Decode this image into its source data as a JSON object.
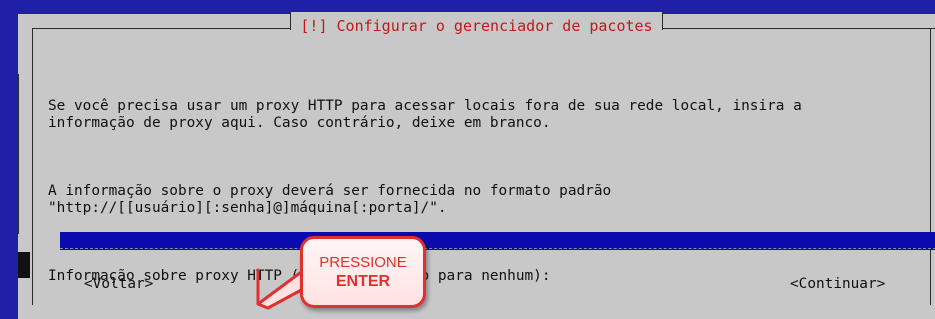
{
  "dialog": {
    "title": "[!] Configurar o gerenciador de pacotes",
    "paragraph1": "Se você precisa usar um proxy HTTP para acessar locais fora de sua rede local, insira a\ninformação de proxy aqui. Caso contrário, deixe em branco.",
    "paragraph2": "A informação sobre o proxy deverá ser fornecida no formato padrão\n\"http://[[usuário][:senha]@]máquina[:porta]/\".",
    "field_label": "Informação sobre proxy HTTP (deixe em branco para nenhum):",
    "field_value": ""
  },
  "buttons": {
    "back": "<Voltar>",
    "continue": "<Continuar>"
  },
  "callout": {
    "line1": "PRESSIONE",
    "line2": "ENTER"
  },
  "colors": {
    "title": "#c21818",
    "input_bar": "#0a0aaf",
    "dialog_bg": "#c8c8c8",
    "backdrop": "#1f1fa8",
    "callout_accent": "#e03030"
  }
}
